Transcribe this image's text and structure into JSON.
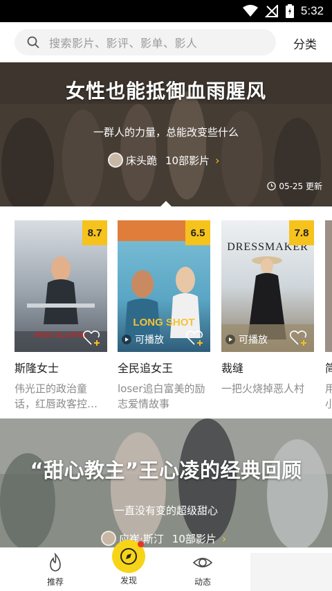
{
  "status_bar": {
    "time": "5:32"
  },
  "search": {
    "placeholder": "搜索影片、影评、影单、影人",
    "category_label": "分类"
  },
  "banner_top": {
    "title": "女性也能抵御血雨腥风",
    "subtitle": "一群人的力量，总能改变些什么",
    "author": "床头跪",
    "count": "10部影片",
    "update": "05-25 更新"
  },
  "movies": [
    {
      "title": "斯隆女士",
      "score": "8.7",
      "desc_line1": "伟光正的政治童",
      "desc_line2": "话，红唇政客控…",
      "playable": false,
      "poster_text": "MISS SLOANE"
    },
    {
      "title": "全民追女王",
      "score": "6.5",
      "desc_line1": "loser追白富美的励",
      "desc_line2": "志爱情故事",
      "playable": true,
      "play_label": "可播放",
      "poster_text": "LONG SHOT"
    },
    {
      "title": "裁缝",
      "score": "7.8",
      "desc_line1": "一把火烧掉恶人村",
      "desc_line2": "",
      "playable": true,
      "play_label": "可播放",
      "poster_text": "DRESSMAKER"
    },
    {
      "title": "简",
      "score": "",
      "desc_line1": "用",
      "desc_line2": "小",
      "playable": false,
      "poster_text": ""
    }
  ],
  "banner_bottom": {
    "title": "“甜心教主”王心凌的经典回顾",
    "subtitle": "一直没有变的超级甜心",
    "author": "应崔·斯汀",
    "count": "10部影片"
  },
  "bottom_nav": [
    {
      "label": "推荐",
      "icon": "flame-icon"
    },
    {
      "label": "发现",
      "icon": "compass-icon"
    },
    {
      "label": "动态",
      "icon": "eye-icon"
    }
  ],
  "colors": {
    "accent": "#f6c21c",
    "discover": "#f6d418",
    "badge_red": "#e8342a"
  }
}
